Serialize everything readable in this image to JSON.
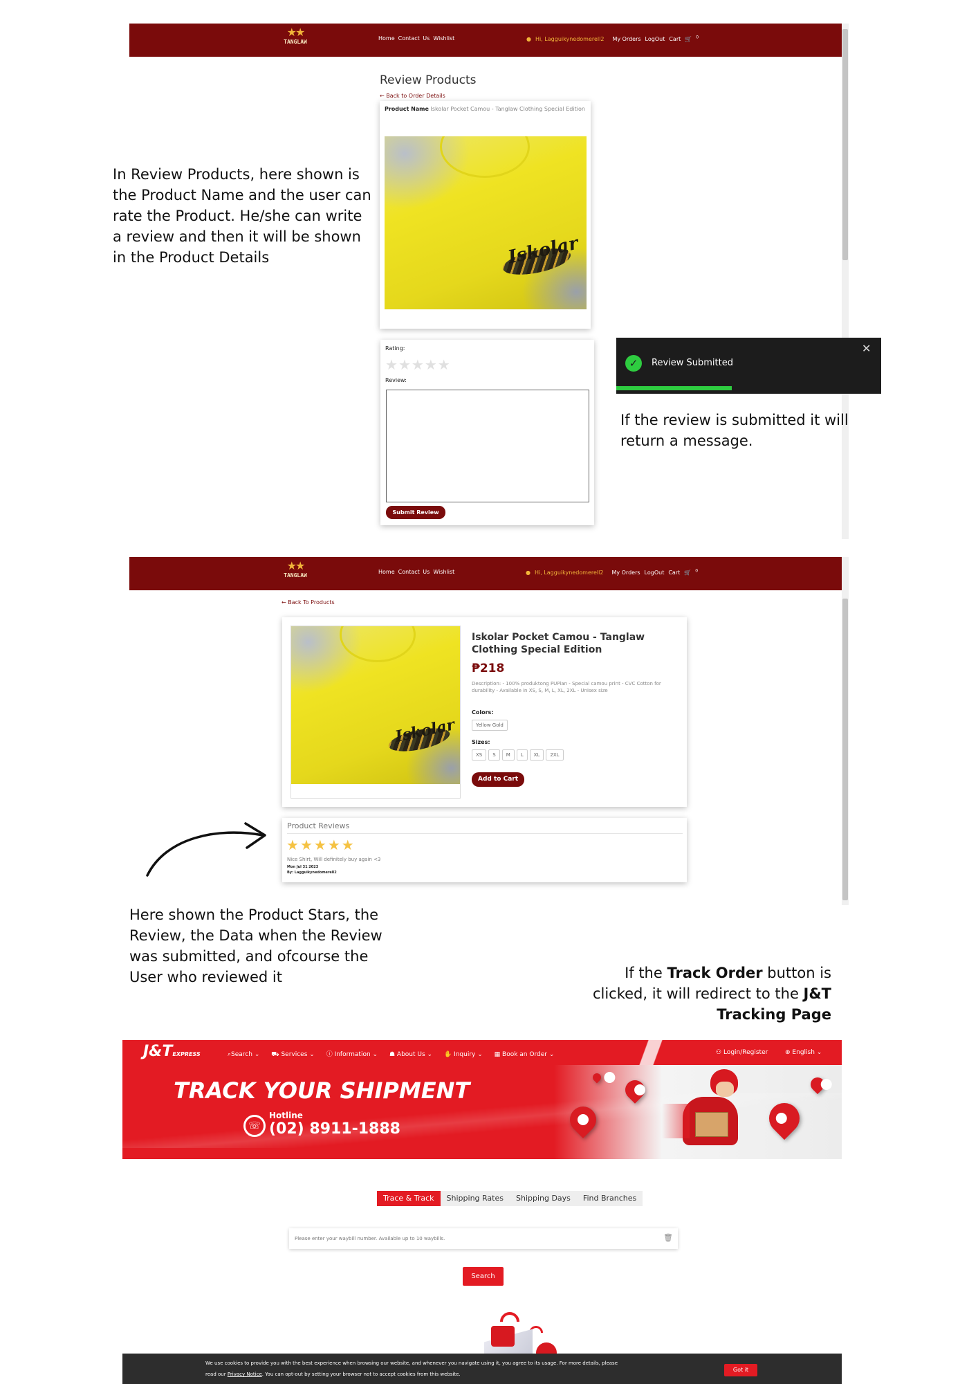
{
  "navbar": {
    "brand": "TANGLAW",
    "links": [
      "Home",
      "Contact Us",
      "Wishlist"
    ],
    "user_greeting": "Hi, Lagguikynedomerell2",
    "user_greeting_2": "Hi, Lagguikynedomerell2",
    "my_orders": "My Orders",
    "logout": "LogOut",
    "cart": "Cart",
    "cart_count": "0"
  },
  "review_page": {
    "title": "Review Products",
    "back_link": "← Back to Order Details",
    "product_name_label": "Product Name",
    "product_name_value": "Iskolar Pocket Camou - Tanglaw Clothing Special Edition",
    "rating_label": "Rating:",
    "rating_value": 0,
    "review_label": "Review:",
    "review_value": "",
    "submit_label": "Submit Review"
  },
  "toast": {
    "message": "Review Submitted",
    "close": "✕",
    "progress": 0.5
  },
  "annotations": {
    "review_text": "In Review Products, here shown is the Product Name and the user can rate the Product. He/she can write a review and then it will be shown in the Product Details",
    "toast_text": "If the review is submitted it will return a message.",
    "stars_text": "Here shown the Product Stars, the Review, the Data when the Review was submitted, and ofcourse the User who reviewed it",
    "track_prefix": "If the ",
    "track_bold1": "Track Order",
    "track_mid": " button is clicked, it will redirect to the ",
    "track_bold2": "J&T Tracking Page"
  },
  "product_page": {
    "back_link": "← Back To Products",
    "name": "Iskolar Pocket Camou - Tanglaw Clothing Special Edition",
    "price": "₱218",
    "description": "Description: - 100% produktong PUPian - Special camou print - CVC Cotton for durability - Available in XS, S, M, L, XL, 2XL - Unisex size",
    "colors_label": "Colors:",
    "colors": [
      "Yellow Gold"
    ],
    "sizes_label": "Sizes:",
    "sizes": [
      "XS",
      "S",
      "M",
      "L",
      "XL",
      "2XL"
    ],
    "add_to_cart": "Add to Cart",
    "shirt_print": "Iskolar",
    "reviews_title": "Product Reviews",
    "review": {
      "stars": 5,
      "text": "Nice Shirt, Will definitely buy again <3",
      "date": "Mon Jul 31 2023",
      "by": "By: Lagguikynedomerell2"
    }
  },
  "jt": {
    "logo": "J&T",
    "logo_sub": "EXPRESS",
    "nav": [
      "Search",
      "Services",
      "Information",
      "About Us",
      "Inquiry",
      "Book an Order"
    ],
    "login": "Login/Register",
    "language": "English",
    "hero_title": "TRACK YOUR SHIPMENT",
    "hotline_label": "Hotline",
    "hotline_number": "(02) 8911-1888",
    "tabs": [
      "Trace & Track",
      "Shipping Rates",
      "Shipping Days",
      "Find Branches"
    ],
    "input_placeholder": "Please enter your waybill number. Available up to 10 waybills.",
    "search_button": "Search",
    "cookie_text_1": "We use cookies to provide you with the best experience when browsing our website, and whenever you navigate using it, you agree to its usage. For more details, please",
    "cookie_text_2a": "read our ",
    "cookie_link": "Privacy Notice",
    "cookie_text_2b": ". You can opt-out by setting your browser not to accept cookies from this website.",
    "cookie_button": "Got it"
  },
  "colors": {
    "tanglaw_maroon": "#7a0b0b",
    "tanglaw_gold": "#f2b53a",
    "jt_red": "#e31b23",
    "toast_bg": "#1c1c1c",
    "toast_success": "#2ecc40"
  }
}
